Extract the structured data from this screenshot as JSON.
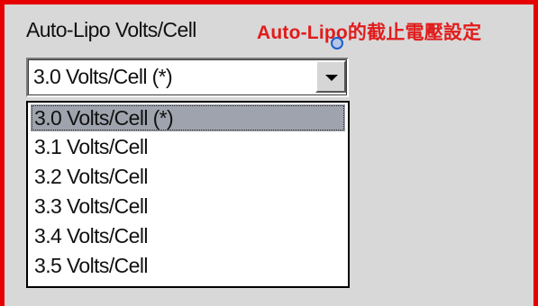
{
  "field": {
    "label": "Auto-Lipo Volts/Cell",
    "annotation": "Auto-Lipo的截止電壓設定"
  },
  "combo": {
    "value": "3.0 Volts/Cell (*)",
    "button_icon": "chevron-down-icon"
  },
  "dropdown": {
    "selected_index": 0,
    "options": [
      "3.0 Volts/Cell (*)",
      "3.1 Volts/Cell",
      "3.2 Volts/Cell",
      "3.3 Volts/Cell",
      "3.4 Volts/Cell",
      "3.5 Volts/Cell"
    ]
  },
  "colors": {
    "frame_border": "#e60000",
    "annotation_text": "#e21b1b",
    "panel_bg": "#d8d8d8",
    "selection_bg": "#9fa3ad"
  }
}
